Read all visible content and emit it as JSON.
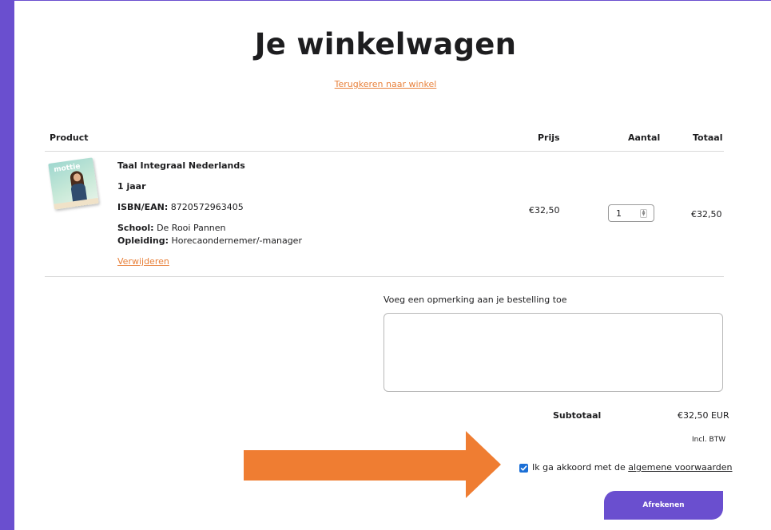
{
  "page": {
    "title": "Je winkelwagen",
    "back_link": "Terugkeren naar winkel"
  },
  "table": {
    "headers": {
      "product": "Product",
      "price": "Prijs",
      "quantity": "Aantal",
      "total": "Totaal"
    }
  },
  "item": {
    "cover_text": "mottie",
    "name": "Taal Integraal Nederlands",
    "duration": "1 jaar",
    "isbn_label": "ISBN/EAN:",
    "isbn": "8720572963405",
    "school_label": "School:",
    "school": "De Rooi Pannen",
    "education_label": "Opleiding:",
    "education": "Horecaondernemer/-manager",
    "remove_label": "Verwijderen",
    "price": "€32,50",
    "quantity": "1",
    "total": "€32,50"
  },
  "note": {
    "label": "Voeg een opmerking aan je bestelling toe",
    "value": ""
  },
  "summary": {
    "subtotal_label": "Subtotaal",
    "subtotal_value": "€32,50 EUR",
    "tax_note": "Incl. BTW"
  },
  "terms": {
    "checked": true,
    "text": "Ik ga akkoord met de",
    "link": "algemene voorwaarden"
  },
  "checkout": {
    "label": "Afrekenen"
  },
  "icons": {
    "quantity_spinner": "stepper-icon",
    "checkmark": "check-icon",
    "annotation_arrow": "arrow-right-icon"
  },
  "colors": {
    "brand_purple": "#6a4fcf",
    "link_orange": "#e8803a",
    "arrow_orange": "#ef7d32",
    "checkbox_blue": "#1b6fd6"
  }
}
